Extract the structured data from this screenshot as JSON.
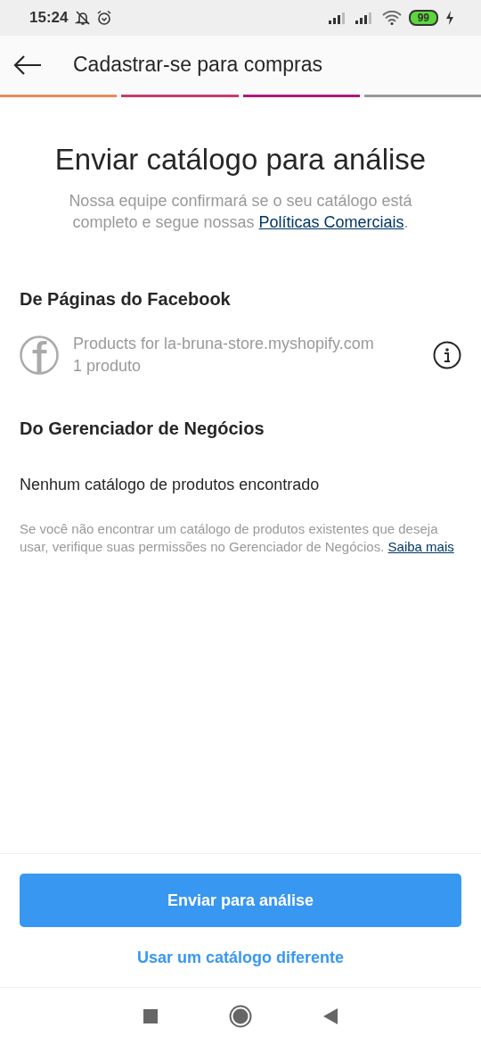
{
  "status_bar": {
    "time": "15:24",
    "battery": "99"
  },
  "header": {
    "title": "Cadastrar-se para compras"
  },
  "steps": [
    {
      "done": true,
      "color": "#e98a5a"
    },
    {
      "done": true,
      "color": "#c93a6a"
    },
    {
      "done": true,
      "color": "#b0167e"
    },
    {
      "done": false
    }
  ],
  "title": "Enviar catálogo para análise",
  "subtitle": {
    "text": "Nossa equipe confirmará se o seu catálogo está completo e segue nossas ",
    "link": "Políticas Comerciais",
    "end": "."
  },
  "sections": [
    {
      "heading": "De Páginas do Facebook",
      "kind": "catalogs",
      "items": [
        {
          "name": "Products for la-bruna-store.myshopify.com",
          "count": "1 produto"
        }
      ]
    },
    {
      "heading": "Do Gerenciador de Negócios",
      "kind": "empty",
      "message": "Nenhum catálogo de produtos encontrado",
      "note": "Se você não encontrar um catálogo de produtos existentes que deseja usar, verifique suas permissões no Gerenciador de Negócios. ",
      "note_link": "Saiba mais"
    }
  ],
  "primary_button": "Enviar para análise",
  "secondary_link": "Usar um catálogo diferente"
}
